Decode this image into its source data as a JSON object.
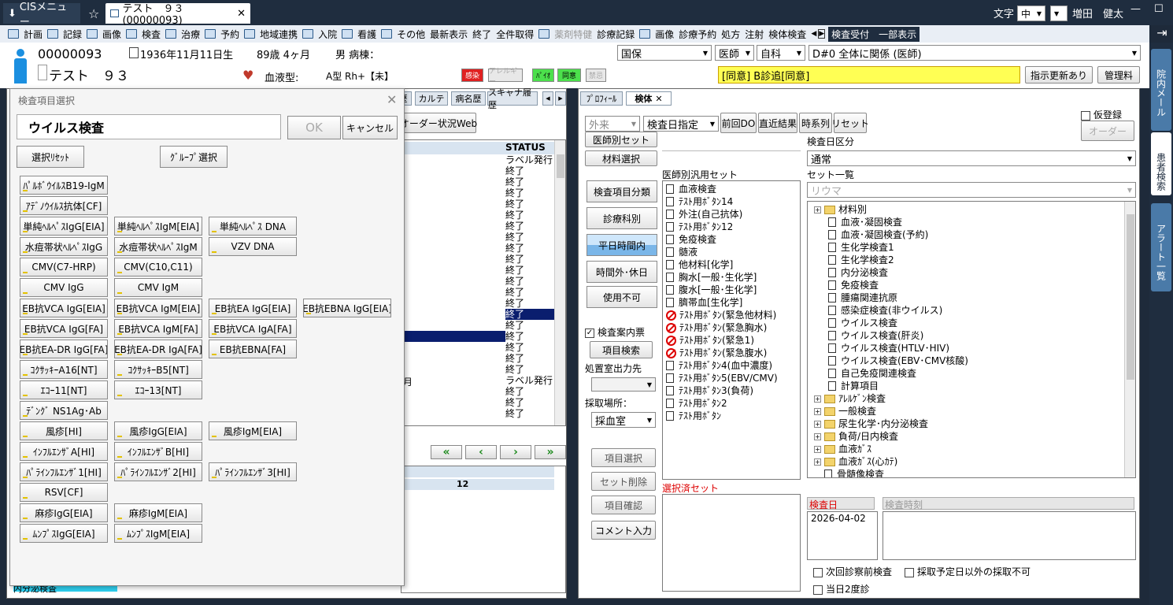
{
  "titlebar": {
    "cis_menu": "CISメニュー",
    "tab_title": "テスト　９３(00000093)",
    "font_label": "文字",
    "font_size": "中",
    "user_name": "増田　健太"
  },
  "menu": {
    "items": [
      "計画",
      "記録",
      "画像",
      "検査",
      "治療",
      "予約",
      "地域連携",
      "入院",
      "看護",
      "その他",
      "最新表示",
      "終了",
      "全件取得",
      "薬剤特健",
      "診療記録",
      "画像",
      "診療予約",
      "処方",
      "注射",
      "検体検査"
    ],
    "right_button": "検査受付　一部表示"
  },
  "patient": {
    "id": "00000093",
    "name": "テスト　９３",
    "birth": "1936年11月11日生",
    "age": "89歳 4ヶ月",
    "sex_ward": "男 病棟：",
    "blood_label": "血液型:",
    "blood_value": "A型 Rh+【未】",
    "tags": [
      "感染",
      "アレルギー",
      "ﾊﾟｲｵ",
      "同意",
      "禁忌"
    ],
    "insurance": "国保",
    "doctor": "医師",
    "dept": "自科",
    "disease": "D#0  全体に関係 (医師)",
    "notice": "[同意] B診追[同意]",
    "btn_update": "指示更新あり",
    "btn_manage": "管理料"
  },
  "sidebar": [
    "院内メール",
    "患者検索",
    "アラート一覧"
  ],
  "left_panel": {
    "tabs": [
      "歴",
      "カルテ",
      "病名歴",
      "スキャナ履歴"
    ],
    "order_web": "オーダー状況Web",
    "status_header": "STATUS",
    "statuses": [
      "ラベル発行",
      "終了",
      "終了",
      "終了",
      "終了",
      "終了",
      "終了",
      "終了",
      "終了",
      "終了",
      "終了",
      "終了",
      "終了",
      "終了",
      "終了",
      "終了",
      "終了",
      "終了",
      "終了",
      "終了",
      "ラベル発行",
      "終了",
      "終了",
      "終了"
    ],
    "month_fragment": "月",
    "count": "12",
    "bottom_row": "内分泌検査"
  },
  "dialog": {
    "title": "検査項目選択",
    "group_name": "ウイルス検査",
    "ok": "OK",
    "cancel": "キャンセル",
    "reset": "選択ﾘｾｯﾄ",
    "group_select": "ｸﾞﾙｰﾌﾟ選択",
    "buttons": [
      [
        "ﾊﾟﾙﾎﾞｳｲﾙｽB19-IgM"
      ],
      [
        "ｱﾃﾞﾉｳｲﾙｽ抗体[CF]"
      ],
      [
        "単純ﾍﾙﾍﾟｽIgG[EIA]",
        "単純ﾍﾙﾍﾟｽIgM[EIA]",
        "単純ﾍﾙﾍﾟｽ DNA"
      ],
      [
        "水痘帯状ﾍﾙﾍﾟｽIgG",
        "水痘帯状ﾍﾙﾍﾟｽIgM",
        "VZV DNA"
      ],
      [
        "CMV(C7-HRP)",
        "CMV(C10,C11)"
      ],
      [
        "CMV IgG",
        "CMV IgM"
      ],
      [
        "EB抗VCA IgG[EIA]",
        "EB抗VCA IgM[EIA]",
        "EB抗EA IgG[EIA]",
        "EB抗EBNA IgG[EIA]"
      ],
      [
        "EB抗VCA IgG[FA]",
        "EB抗VCA IgM[FA]",
        "EB抗VCA IgA[FA]"
      ],
      [
        "EB抗EA-DR IgG[FA]",
        "EB抗EA-DR IgA[FA]",
        "EB抗EBNA[FA]"
      ],
      [
        "ｺｸｻｯｷｰA16[NT]",
        "ｺｸｻｯｷｰB5[NT]"
      ],
      [
        "ｴｺｰ11[NT]",
        "ｴｺｰ13[NT]"
      ],
      [
        "ﾃﾞﾝｸﾞ NS1Ag･Ab"
      ],
      [
        "風疹[HI]",
        "風疹IgG[EIA]",
        "風疹IgM[EIA]"
      ],
      [
        "ｲﾝﾌﾙｴﾝｻﾞA[HI]",
        "ｲﾝﾌﾙｴﾝｻﾞB[HI]"
      ],
      [
        "ﾊﾟﾗｲﾝﾌﾙｴﾝｻﾞ1[HI]",
        "ﾊﾟﾗｲﾝﾌﾙｴﾝｻﾞ2[HI]",
        "ﾊﾟﾗｲﾝﾌﾙｴﾝｻﾞ3[HI]"
      ],
      [
        "RSV[CF]"
      ],
      [
        "麻疹IgG[EIA]",
        "麻疹IgM[EIA]"
      ],
      [
        "ﾑﾝﾌﾟｽIgG[EIA]",
        "ﾑﾝﾌﾟｽIgM[EIA]"
      ]
    ]
  },
  "right_panel": {
    "tabs": [
      "ﾌﾟﾛﾌｨｰﾙ",
      "検体"
    ],
    "visit_type": "外来",
    "date_mode": "検査日指定",
    "btn_prev_do": "前回DO",
    "btn_recent": "直近結果",
    "btn_timeline": "時系列",
    "btn_reset": "リセット",
    "provisional": "仮登録",
    "order": "オーダー",
    "btn_doctor_set": "医師別セット",
    "btn_material": "材料選択",
    "exam_date_div_label": "検査日区分",
    "exam_date_div": "通常",
    "set_list_label": "セット一覧",
    "set_list_value": "リウマ",
    "doctor_set_label": "医師別汎用セット",
    "side_buttons": [
      "検査項目分類",
      "診療科別",
      "平日時間内",
      "時間外･休日",
      "使用不可"
    ],
    "exam_guide": "検査案内票",
    "item_search": "項目検索",
    "output_label": "処置室出力先",
    "collect_label": "採取場所：",
    "collect_value": "採血室",
    "item_select": "項目選択",
    "set_delete": "セット削除",
    "item_confirm": "項目確認",
    "comment": "コメント入力",
    "selected_set_label": "選択済セット",
    "exam_date_label": "検査日",
    "exam_time_label": "検査時刻",
    "exam_date_value": "2026-04-02",
    "check_next": "次回診察前検査",
    "check_no_other": "採取予定日以外の採取不可",
    "check_sameday": "当日2度診",
    "doctor_sets": [
      {
        "label": "血液検査",
        "icon": "doc"
      },
      {
        "label": "ﾃｽﾄ用ﾎﾞﾀﾝ14",
        "icon": "doc"
      },
      {
        "label": "外注(自己抗体)",
        "icon": "doc"
      },
      {
        "label": "ﾃｽﾄ用ﾎﾞﾀﾝ12",
        "icon": "doc"
      },
      {
        "label": "免疫検査",
        "icon": "doc"
      },
      {
        "label": "髄液",
        "icon": "doc"
      },
      {
        "label": "他材料[化学]",
        "icon": "doc"
      },
      {
        "label": "胸水[一般･生化学]",
        "icon": "doc"
      },
      {
        "label": "腹水[一般･生化学]",
        "icon": "doc"
      },
      {
        "label": "臍帯血[生化学]",
        "icon": "doc"
      },
      {
        "label": "ﾃｽﾄ用ﾎﾞﾀﾝ(緊急他材料)",
        "icon": "ban"
      },
      {
        "label": "ﾃｽﾄ用ﾎﾞﾀﾝ(緊急胸水)",
        "icon": "ban"
      },
      {
        "label": "ﾃｽﾄ用ﾎﾞﾀﾝ(緊急1)",
        "icon": "ban"
      },
      {
        "label": "ﾃｽﾄ用ﾎﾞﾀﾝ(緊急腹水)",
        "icon": "ban"
      },
      {
        "label": "ﾃｽﾄ用ﾎﾞﾀﾝ4(血中濃度)",
        "icon": "doc"
      },
      {
        "label": "ﾃｽﾄ用ﾎﾞﾀﾝ5(EBV/CMV)",
        "icon": "doc"
      },
      {
        "label": "ﾃｽﾄ用ﾎﾞﾀﾝ3(負荷)",
        "icon": "doc"
      },
      {
        "label": "ﾃｽﾄ用ﾎﾞﾀﾝ2",
        "icon": "doc"
      },
      {
        "label": "ﾃｽﾄ用ﾎﾞﾀﾝ",
        "icon": "doc"
      }
    ],
    "tree": [
      {
        "label": "材料別",
        "type": "folder",
        "level": 0,
        "exp": "+"
      },
      {
        "label": "血液･凝固検査",
        "type": "doc",
        "level": 1
      },
      {
        "label": "血液･凝固検査(予約)",
        "type": "doc",
        "level": 1
      },
      {
        "label": "生化学検査1",
        "type": "doc",
        "level": 1
      },
      {
        "label": "生化学検査2",
        "type": "doc",
        "level": 1
      },
      {
        "label": "内分泌検査",
        "type": "doc",
        "level": 1
      },
      {
        "label": "免疫検査",
        "type": "doc",
        "level": 1
      },
      {
        "label": "腫瘍関連抗原",
        "type": "doc",
        "level": 1
      },
      {
        "label": "感染症検査(非ウイルス)",
        "type": "doc",
        "level": 1
      },
      {
        "label": "ウイルス検査",
        "type": "doc",
        "level": 1
      },
      {
        "label": "ウイルス検査(肝炎)",
        "type": "doc",
        "level": 1
      },
      {
        "label": "ウイルス検査(HTLV･HIV)",
        "type": "doc",
        "level": 1
      },
      {
        "label": "ウイルス検査(EBV･CMV核酸)",
        "type": "doc",
        "level": 1
      },
      {
        "label": "自己免疫関連検査",
        "type": "doc",
        "level": 1
      },
      {
        "label": "計算項目",
        "type": "doc",
        "level": 1
      },
      {
        "label": "ｱﾚﾙｹﾞﾝ検査",
        "type": "folder",
        "level": 0,
        "exp": "+"
      },
      {
        "label": "一般検査",
        "type": "folder",
        "level": 0,
        "exp": "+"
      },
      {
        "label": "尿生化学･内分泌検査",
        "type": "folder",
        "level": 0,
        "exp": "+"
      },
      {
        "label": "負荷/日内検査",
        "type": "folder",
        "level": 0,
        "exp": "+"
      },
      {
        "label": "血液ｶﾞｽ",
        "type": "folder",
        "level": 0,
        "exp": "+"
      },
      {
        "label": "血液ｶﾞｽ(心ｶﾃ)",
        "type": "folder",
        "level": 0,
        "exp": "+"
      },
      {
        "label": "骨髄像検査",
        "type": "doc",
        "level": 0
      }
    ]
  }
}
